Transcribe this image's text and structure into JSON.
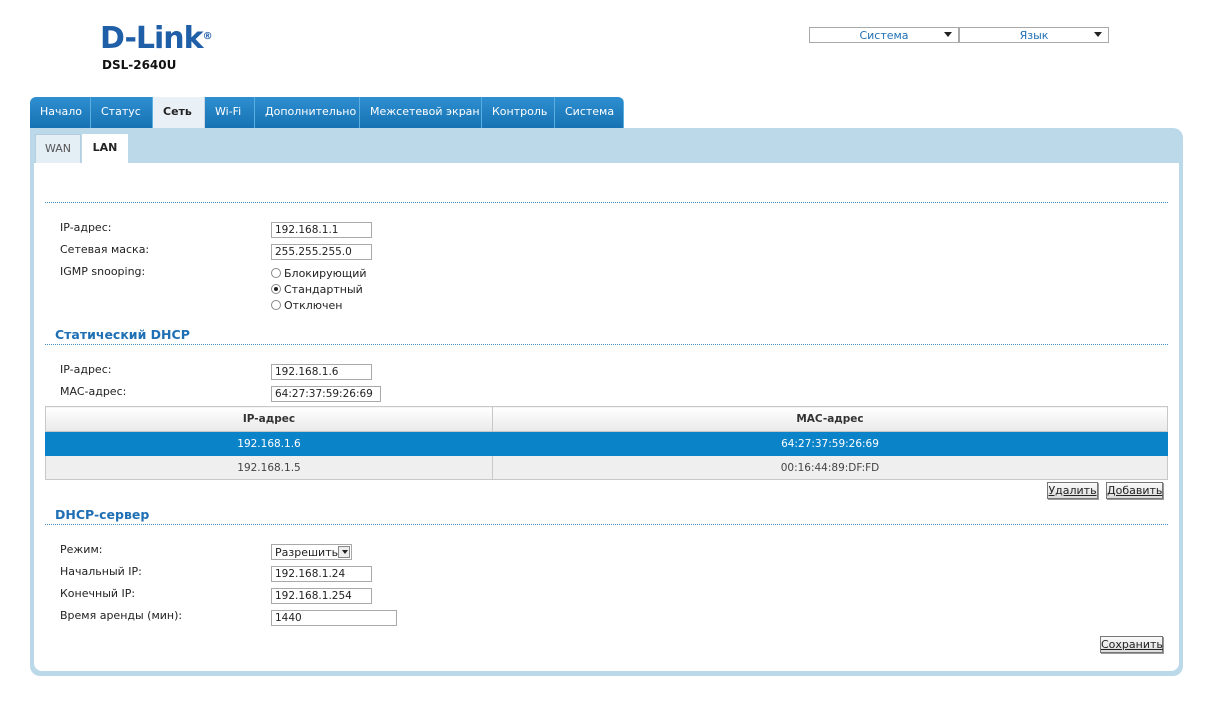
{
  "brand": {
    "logo": "D-Link",
    "registered": "®",
    "model": "DSL-2640U"
  },
  "top": {
    "system_select": "Система",
    "language_select": "Язык"
  },
  "main_tabs": [
    "Начало",
    "Статус",
    "Сеть",
    "Wi-Fi",
    "Дополнительно",
    "Межсетевой экран",
    "Контроль",
    "Система"
  ],
  "sub_tabs": {
    "wan": "WAN",
    "lan": "LAN"
  },
  "lan": {
    "ip_label": "IP-адрес:",
    "ip_value": "192.168.1.1",
    "mask_label": "Сетевая маска:",
    "mask_value": "255.255.255.0",
    "igmp_label": "IGMP snooping:",
    "igmp_options": [
      "Блокирующий",
      "Стандартный",
      "Отключен"
    ]
  },
  "static_dhcp": {
    "title": "Статический DHCP",
    "ip_label": "IP-адрес:",
    "ip_value": "192.168.1.6",
    "mac_label": "MAC-адрес:",
    "mac_value": "64:27:37:59:26:69",
    "table": {
      "headers": [
        "IP-адрес",
        "MAC-адрес"
      ],
      "rows": [
        [
          "192.168.1.6",
          "64:27:37:59:26:69"
        ],
        [
          "192.168.1.5",
          "00:16:44:89:DF:FD"
        ]
      ]
    },
    "delete_button": "Удалить",
    "add_button": "Добавить"
  },
  "dhcp_server": {
    "title": "DHCP-сервер",
    "mode_label": "Режим:",
    "mode_value": "Разрешить",
    "start_label": "Начальный IP:",
    "start_value": "192.168.1.24",
    "end_label": "Конечный IP:",
    "end_value": "192.168.1.254",
    "lease_label": "Время аренды (мин):",
    "lease_value": "1440",
    "save_button": "Сохранить"
  }
}
